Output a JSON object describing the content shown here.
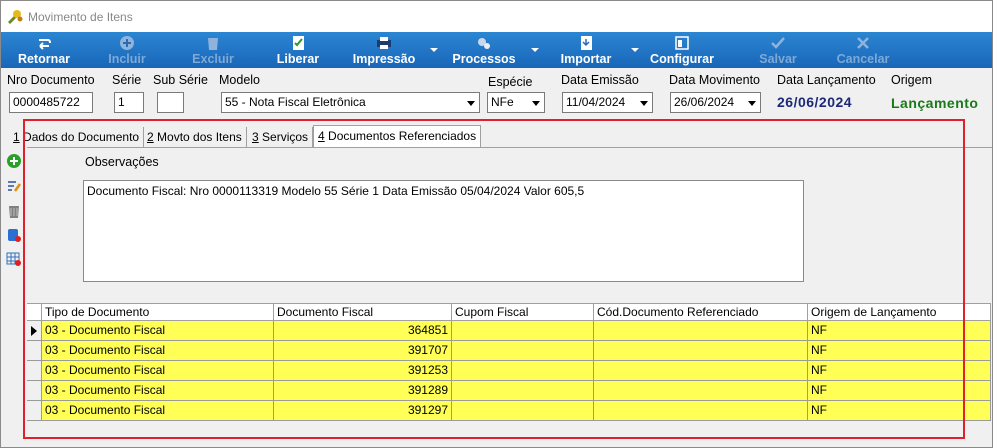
{
  "window": {
    "title": "Movimento de Itens"
  },
  "toolbar": {
    "retornar": "Retornar",
    "incluir": "Incluir",
    "excluir": "Excluir",
    "liberar": "Liberar",
    "impressao": "Impressão",
    "processos": "Processos",
    "importar": "Importar",
    "configurar": "Configurar",
    "salvar": "Salvar",
    "cancelar": "Cancelar"
  },
  "fields": {
    "nro_documento": {
      "label": "Nro Documento",
      "value": "0000485722"
    },
    "serie": {
      "label": "Série",
      "value": "1"
    },
    "sub_serie": {
      "label": "Sub Série",
      "value": ""
    },
    "modelo": {
      "label": "Modelo",
      "value": "55 - Nota Fiscal Eletrônica"
    },
    "especie": {
      "label": "Espécie",
      "value": "NFe"
    },
    "data_emissao": {
      "label": "Data Emissão",
      "value": "11/04/2024"
    },
    "data_movimento": {
      "label": "Data Movimento",
      "value": "26/06/2024"
    },
    "data_lancamento": {
      "label": "Data Lançamento",
      "value": "26/06/2024"
    },
    "origem": {
      "label": "Origem",
      "value": "Lançamento"
    }
  },
  "colors": {
    "lancamento_date": "#1b2a78",
    "origem_value": "#1a7a1a",
    "row_highlight": "#ffff55",
    "toolbar": "#1e6fc1",
    "annotation": "#e0202a"
  },
  "tabs": [
    {
      "key": "1",
      "label": "Dados do Documento"
    },
    {
      "key": "2",
      "label": "Movto dos Itens"
    },
    {
      "key": "3",
      "label": "Serviços"
    },
    {
      "key": "4",
      "label": "Documentos Referenciados"
    }
  ],
  "sidebar_icons": [
    "add-icon",
    "edit-icon",
    "trash-icon",
    "database-icon",
    "grid-icon"
  ],
  "observacoes": {
    "label": "Observações",
    "text": "Documento Fiscal: Nro 0000113319 Modelo 55 Série 1 Data Emissão 05/04/2024 Valor 605,5"
  },
  "grid": {
    "columns": [
      "Tipo de Documento",
      "Documento Fiscal",
      "Cupom Fiscal",
      "Cód.Documento Referenciado",
      "Origem de Lançamento"
    ],
    "rows": [
      [
        "03 - Documento Fiscal",
        "364851",
        "",
        "",
        "NF"
      ],
      [
        "03 - Documento Fiscal",
        "391707",
        "",
        "",
        "NF"
      ],
      [
        "03 - Documento Fiscal",
        "391253",
        "",
        "",
        "NF"
      ],
      [
        "03 - Documento Fiscal",
        "391289",
        "",
        "",
        "NF"
      ],
      [
        "03 - Documento Fiscal",
        "391297",
        "",
        "",
        "NF"
      ]
    ]
  }
}
